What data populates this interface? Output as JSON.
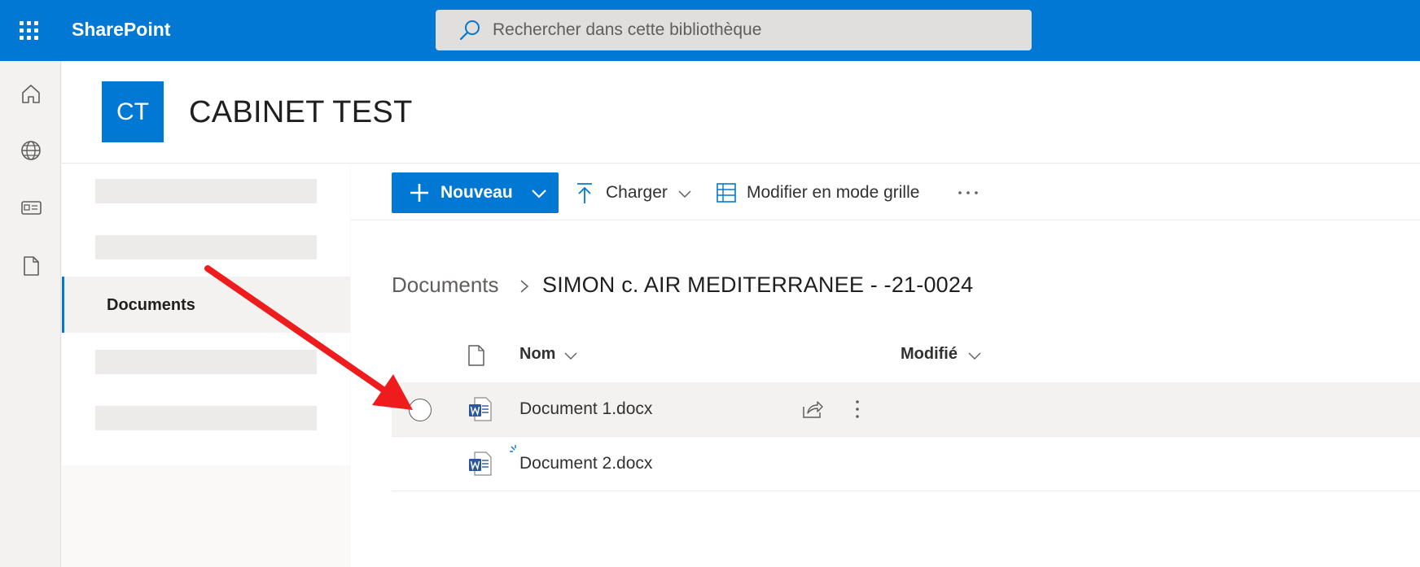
{
  "suitebar": {
    "brand": "SharePoint",
    "search_placeholder": "Rechercher dans cette bibliothèque"
  },
  "appbar": {
    "items": [
      "home-icon",
      "globe-icon",
      "news-icon",
      "document-icon"
    ]
  },
  "site": {
    "logo_text": "CT",
    "title": "CABINET TEST"
  },
  "leftnav": {
    "selected_label": "Documents"
  },
  "commandbar": {
    "new_label": "Nouveau",
    "upload_label": "Charger",
    "grid_label": "Modifier en mode grille"
  },
  "breadcrumb": {
    "root": "Documents",
    "current": "SIMON c. AIR MEDITERRANEE - -21-0024"
  },
  "list": {
    "columns": {
      "name": "Nom",
      "modified": "Modifié"
    },
    "rows": [
      {
        "name": "Document 1.docx"
      },
      {
        "name": "Document 2.docx"
      }
    ]
  },
  "colors": {
    "accent": "#0078d4",
    "annotation_arrow": "#ee1c1c"
  }
}
